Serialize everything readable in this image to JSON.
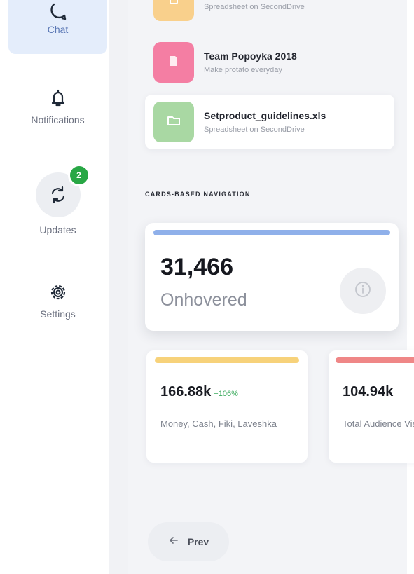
{
  "sidebar": {
    "items": [
      {
        "label": "Chat",
        "icon": "chat-icon"
      },
      {
        "label": "Notifications",
        "icon": "bell-icon"
      },
      {
        "label": "Updates",
        "icon": "refresh-icon",
        "badge": "2"
      },
      {
        "label": "Settings",
        "icon": "gear-icon"
      }
    ]
  },
  "files": [
    {
      "title": "",
      "subtitle": "Spreadsheet on SecondDrive",
      "icon": "file-icon",
      "color": "#f9d08c"
    },
    {
      "title": "Team Popoyka 2018",
      "subtitle": "Make protato everyday",
      "icon": "file-icon",
      "color": "#f47ea3"
    },
    {
      "title": "Setproduct_guidelines.xls",
      "subtitle": "Spreadsheet on SecondDrive",
      "icon": "folder-icon",
      "color": "#a9d8a3"
    }
  ],
  "section": {
    "title": "CARDS-BASED NAVIGATION"
  },
  "big_card": {
    "value": "31,466",
    "label": "Onhovered",
    "accent": "#8fb0ea",
    "icon": "info-icon"
  },
  "small_cards": [
    {
      "value": "166.88k",
      "delta": "+106%",
      "label": "Money, Cash, Fiki, Laveshka",
      "accent": "#f7d27a"
    },
    {
      "value": "104.94k",
      "delta": "",
      "label": "Total Audience Visitors",
      "accent": "#ef8787"
    }
  ],
  "pager": {
    "prev_label": "Prev",
    "icon": "arrow-left-icon"
  }
}
